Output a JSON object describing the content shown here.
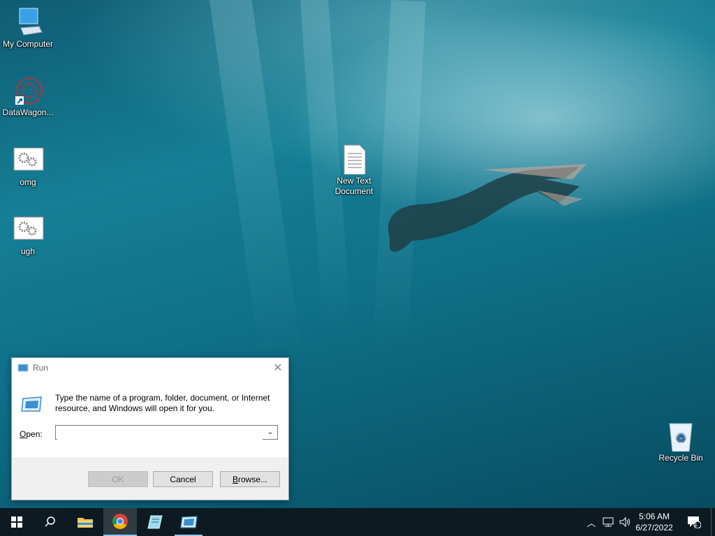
{
  "desktop": {
    "icons": [
      {
        "label": "My Computer"
      },
      {
        "label": "DataWagon..."
      },
      {
        "label": "omg"
      },
      {
        "label": "ugh"
      },
      {
        "label": "New Text\nDocument"
      },
      {
        "label": "Recycle Bin"
      }
    ]
  },
  "run_dialog": {
    "title": "Run",
    "message": "Type the name of a program, folder, document, or Internet resource, and Windows will open it for you.",
    "open_label": "Open:",
    "open_value": "",
    "ok_label": "OK",
    "cancel_label": "Cancel",
    "browse_label": "Browse..."
  },
  "taskbar": {
    "time": "5:06 AM",
    "date": "6/27/2022",
    "notification_count": "1"
  },
  "colors": {
    "taskbar_bg": "#0d1a22",
    "accent": "#8ec6f0"
  }
}
